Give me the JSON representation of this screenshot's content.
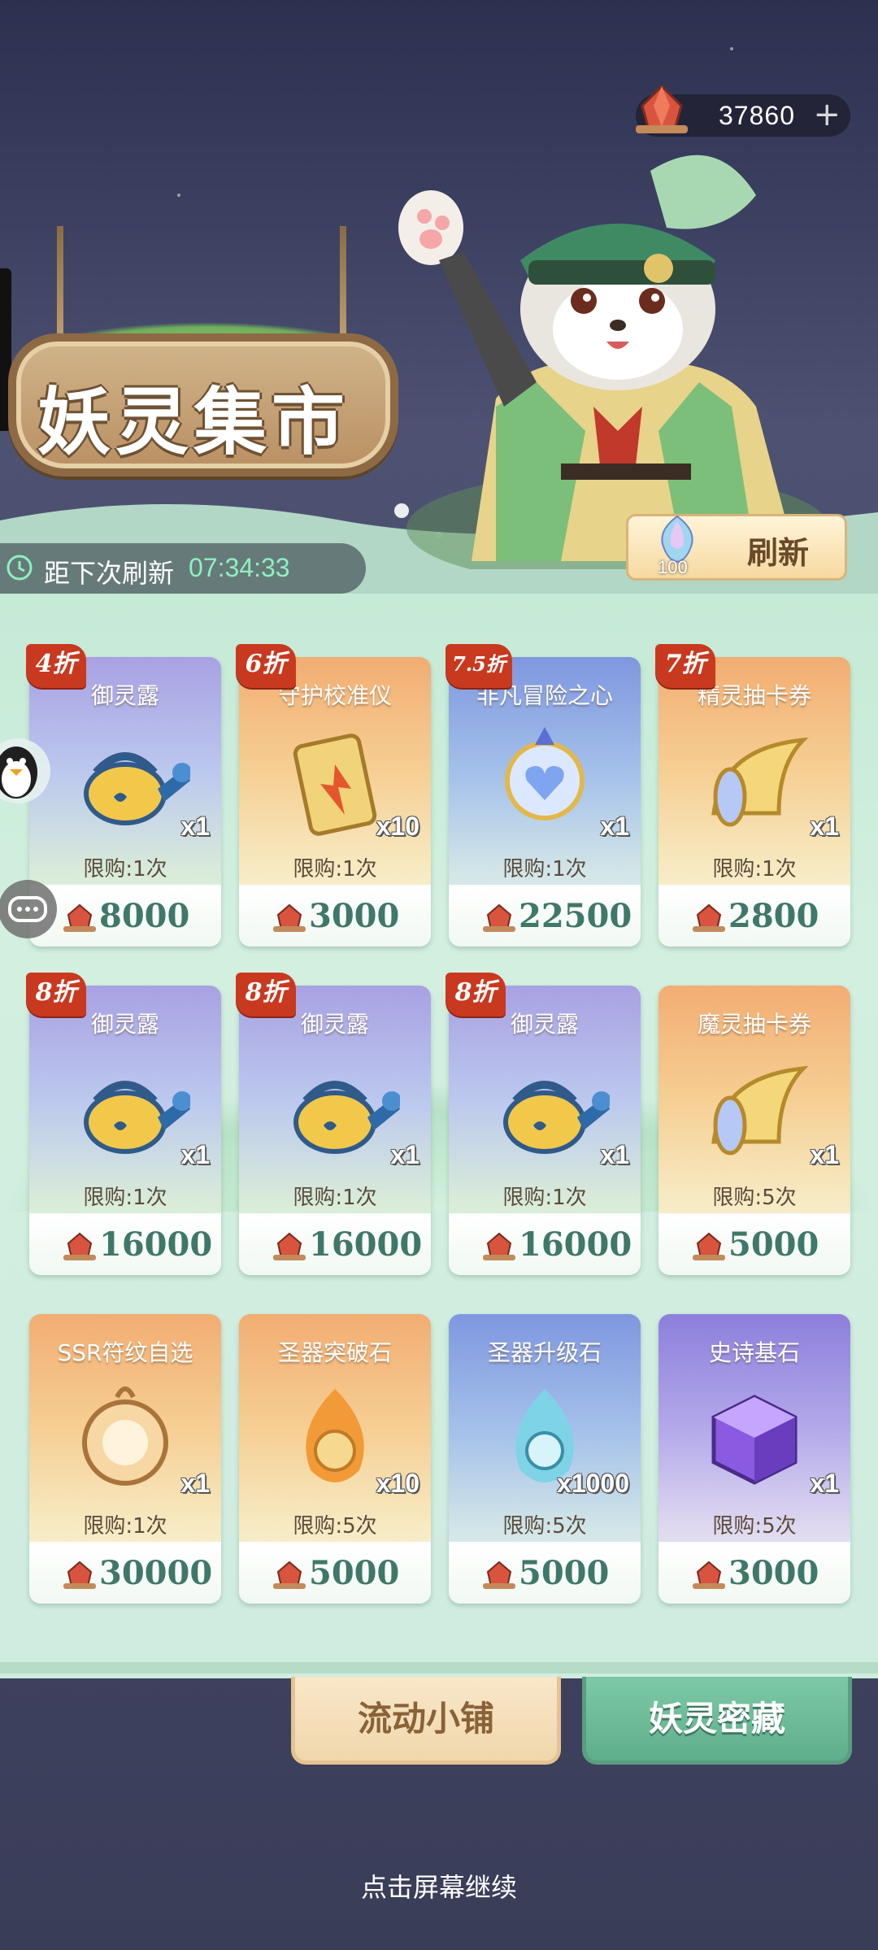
{
  "header": {
    "currency_amount": "37860",
    "currency_plus": "+",
    "shop_title": "妖灵集市",
    "refresh_label": "距下次刷新",
    "refresh_time": "07:34:33",
    "refresh_button_label": "刷新",
    "refresh_cost": "100"
  },
  "items": [
    {
      "name": "御灵露",
      "discount": "4折",
      "qty": "x1",
      "limit": "限购:1次",
      "price": "8000",
      "icon": "watering-can-icon",
      "theme": "purple"
    },
    {
      "name": "守护校准仪",
      "discount": "6折",
      "qty": "x10",
      "limit": "限购:1次",
      "price": "3000",
      "icon": "calibrator-icon",
      "theme": "orange"
    },
    {
      "name": "非凡冒险之心",
      "discount": "7.5折",
      "qty": "x1",
      "limit": "限购:1次",
      "price": "22500",
      "icon": "heart-crystal-icon",
      "theme": "blue"
    },
    {
      "name": "精灵抽卡券",
      "discount": "7折",
      "qty": "x1",
      "limit": "限购:1次",
      "price": "2800",
      "icon": "horn-ticket-icon",
      "theme": "orange"
    },
    {
      "name": "御灵露",
      "discount": "8折",
      "qty": "x1",
      "limit": "限购:1次",
      "price": "16000",
      "icon": "watering-can-icon",
      "theme": "purple"
    },
    {
      "name": "御灵露",
      "discount": "8折",
      "qty": "x1",
      "limit": "限购:1次",
      "price": "16000",
      "icon": "watering-can-icon",
      "theme": "purple"
    },
    {
      "name": "御灵露",
      "discount": "8折",
      "qty": "x1",
      "limit": "限购:1次",
      "price": "16000",
      "icon": "watering-can-icon",
      "theme": "purple"
    },
    {
      "name": "魔灵抽卡券",
      "discount": "",
      "qty": "x1",
      "limit": "限购:5次",
      "price": "5000",
      "icon": "horn-ticket-icon",
      "theme": "orange"
    },
    {
      "name": "SSR符纹自选",
      "discount": "",
      "qty": "x1",
      "limit": "限购:1次",
      "price": "30000",
      "icon": "rune-orb-icon",
      "theme": "orange"
    },
    {
      "name": "圣器突破石",
      "discount": "",
      "qty": "x10",
      "limit": "限购:5次",
      "price": "5000",
      "icon": "flame-stone-icon",
      "theme": "orange"
    },
    {
      "name": "圣器升级石",
      "discount": "",
      "qty": "x1000",
      "limit": "限购:5次",
      "price": "5000",
      "icon": "blue-stone-icon",
      "theme": "blue"
    },
    {
      "name": "史诗基石",
      "discount": "",
      "qty": "x1",
      "limit": "限购:5次",
      "price": "3000",
      "icon": "purple-cube-icon",
      "theme": "violet"
    }
  ],
  "tabs": {
    "shop_label": "流动小铺",
    "secret_label": "妖灵密藏"
  },
  "hint": "点击屏幕继续",
  "colors": {
    "price_text": "#3f7868",
    "discount_tag": "#c9391f",
    "timer_text": "#8ef0c0"
  }
}
